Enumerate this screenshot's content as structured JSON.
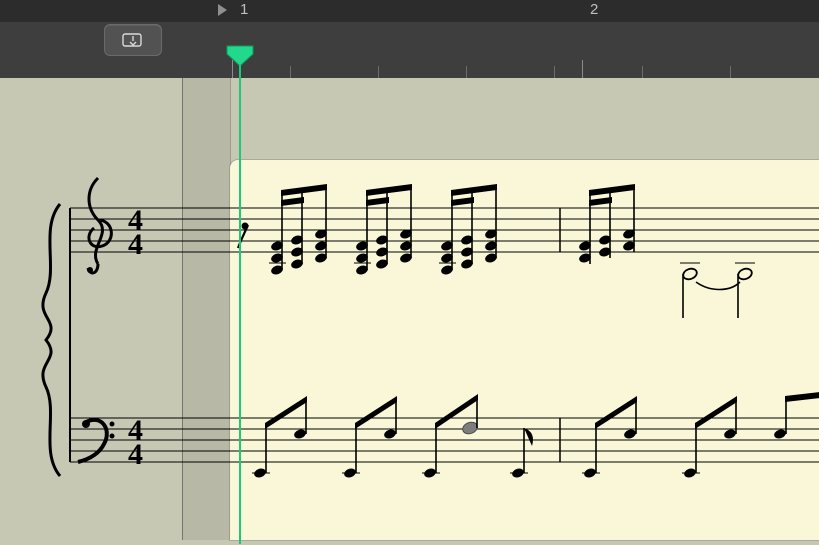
{
  "ruler": {
    "bar1": "1",
    "bar2": "2"
  },
  "timeSignature": {
    "top": "4",
    "bottom": "4"
  },
  "playhead": {
    "bar": 1,
    "beat": 1
  },
  "colors": {
    "playhead": "#1ec77a",
    "regionBg": "#f9f7d8",
    "canvasBg": "#c7c8b3",
    "topbar": "#3e3e3e",
    "rulerStrip": "#2c2c2c"
  },
  "staves": {
    "spacing": 11,
    "treble": {
      "clef": "treble",
      "timeSig": "4/4",
      "bar1": [
        {
          "beat": 1,
          "fig": "eighth-rest"
        },
        {
          "beat": 1.5,
          "chord": [
            "C5",
            "E4",
            "G4"
          ],
          "dur": "16",
          "beamGroup": 1
        },
        {
          "beat": 1.75,
          "chord": [
            "D5",
            "F4",
            "A4"
          ],
          "dur": "16",
          "beamGroup": 1
        },
        {
          "beat": 2,
          "chord": [
            "E5",
            "G4",
            "B4"
          ],
          "dur": "8",
          "beamGroup": 1
        },
        {
          "beat": 2.5,
          "chord": [
            "C5",
            "E4",
            "G4"
          ],
          "dur": "16",
          "beamGroup": 2
        },
        {
          "beat": 2.75,
          "chord": [
            "D5",
            "F4",
            "A4"
          ],
          "dur": "16",
          "beamGroup": 2
        },
        {
          "beat": 3,
          "chord": [
            "E5",
            "G4",
            "B4"
          ],
          "dur": "8",
          "beamGroup": 2
        },
        {
          "beat": 3.5,
          "chord": [
            "C5",
            "E4",
            "G4"
          ],
          "dur": "16",
          "beamGroup": 3
        },
        {
          "beat": 3.75,
          "chord": [
            "D5",
            "F4",
            "A4"
          ],
          "dur": "16",
          "beamGroup": 3
        },
        {
          "beat": 4,
          "chord": [
            "E5",
            "G4",
            "B4"
          ],
          "dur": "8",
          "beamGroup": 3
        }
      ],
      "bar2": [
        {
          "beat": 1,
          "chord": [
            "C5",
            "E4"
          ],
          "dur": "16",
          "beamGroup": 1
        },
        {
          "beat": 1.25,
          "chord": [
            "D5",
            "F4"
          ],
          "dur": "16",
          "beamGroup": 1
        },
        {
          "beat": 1.5,
          "chord": [
            "E5",
            "G4"
          ],
          "dur": "8",
          "beamGroup": 1
        },
        {
          "beat": 2,
          "chord": [
            "G4"
          ],
          "dur": "2",
          "tie": "start"
        },
        {
          "beat": 4,
          "chord": [
            "G4"
          ],
          "dur": "4",
          "tie": "end"
        }
      ]
    },
    "bass": {
      "clef": "bass",
      "timeSig": "4/4",
      "bar1": [
        {
          "beat": 1,
          "note": "C3",
          "dur": "8"
        },
        {
          "beat": 1.5,
          "note": "G3",
          "dur": "8"
        },
        {
          "beat": 2,
          "note": "C3",
          "dur": "8"
        },
        {
          "beat": 2.5,
          "note": "G3",
          "dur": "8"
        },
        {
          "beat": 3,
          "note": "C3",
          "dur": "8",
          "selected": true
        },
        {
          "beat": 3.5,
          "note": "G3",
          "dur": "8"
        },
        {
          "beat": 4,
          "note": "C3",
          "dur": "8"
        }
      ],
      "bar2": [
        {
          "beat": 1,
          "note": "C3",
          "dur": "8"
        },
        {
          "beat": 1.5,
          "note": "G3",
          "dur": "8"
        },
        {
          "beat": 2,
          "note": "C3",
          "dur": "8"
        },
        {
          "beat": 2.5,
          "note": "G3",
          "dur": "8"
        }
      ]
    }
  }
}
